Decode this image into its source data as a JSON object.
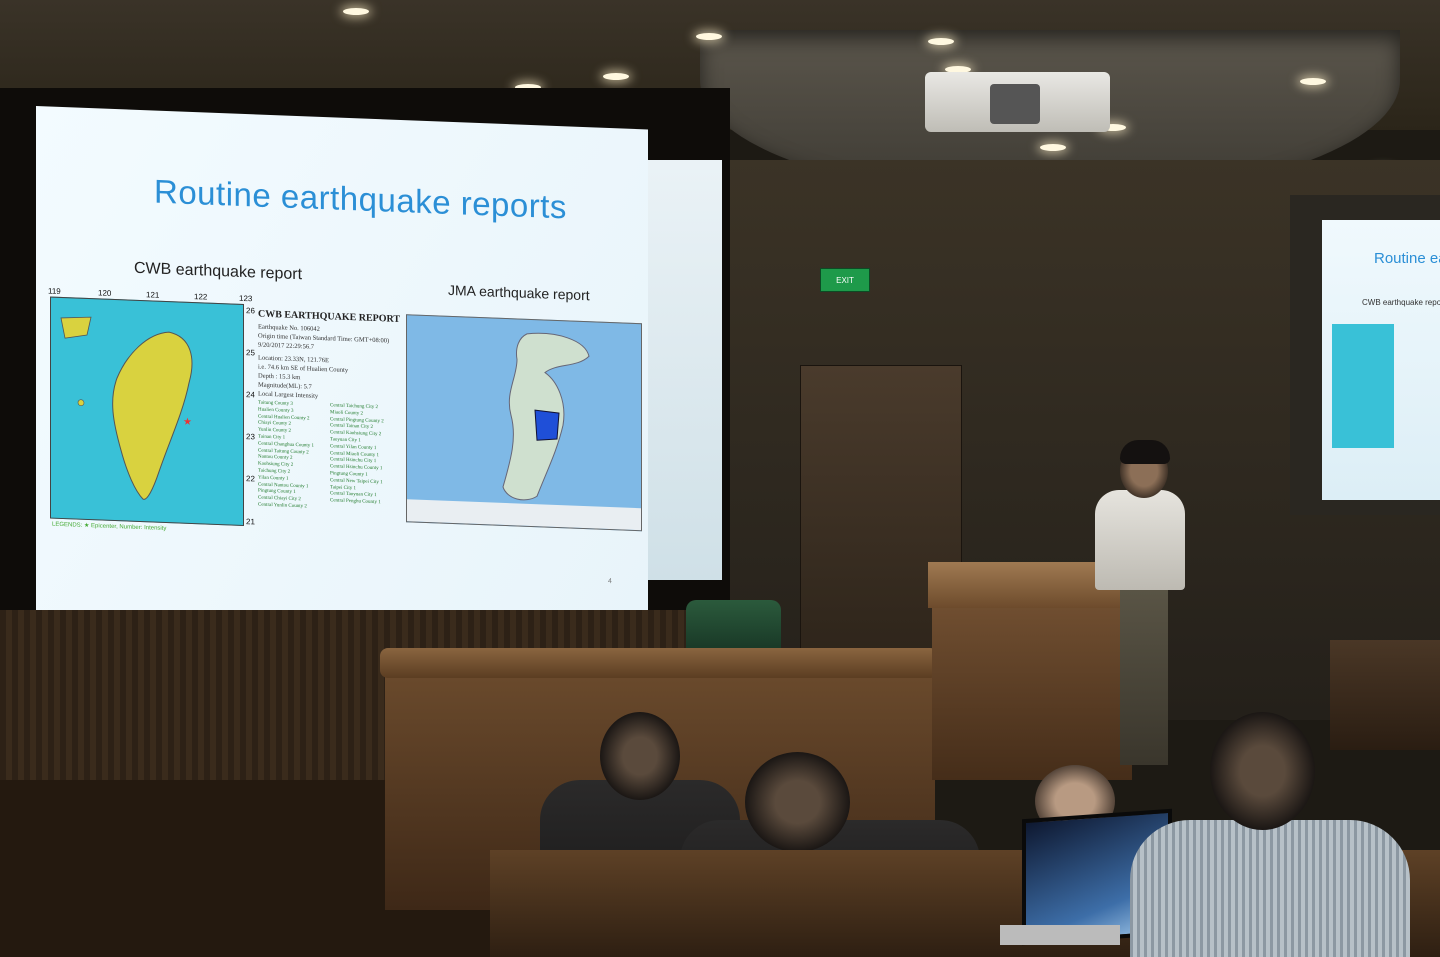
{
  "slide": {
    "title": "Routine earthquake reports",
    "left_caption": "CWB earthquake report",
    "right_caption": "JMA earthquake report",
    "page_number": "4",
    "cwb_report": {
      "heading": "CWB EARTHQUAKE REPORT",
      "lines": [
        "Earthquake No. 106042",
        "Origin time (Taiwan Standard Time: GMT+08:00)",
        "9/20/2017 22:29:56.7",
        "Location: 23.33N, 121.76E",
        "i.e. 74.6 km SE of Hualien County",
        "Depth : 15.3 km",
        "Magnitude(ML): 5.7",
        "Local Largest Intensity"
      ],
      "intensities": [
        "Taitung County 3",
        "Hualien County 3",
        "Central Hualien County 2",
        "Chiayi County 2",
        "Yunlin County 2",
        "Tainan City 1",
        "Central Changhua County 1",
        "Central Taitung County 2",
        "Nantou County 2",
        "Kaohsiung City 2",
        "Taichung City 2",
        "Yilan County 1",
        "Central Nantou County 1",
        "Pingtung County 1",
        "Central Chiayi City 2",
        "Central Yunlin County 2"
      ],
      "intensities_b": [
        "Central Taichung City 2",
        "Miaoli County 2",
        "Central Pingtung County 2",
        "Central Tainan City 2",
        "Central Kaohsiung City 2",
        "Taoyuan City 1",
        "Central Yilan County 1",
        "Central Miaoli County 1",
        "Central Hsinchu City 1",
        "Central Hsinchu County 1",
        "Pingtung County 1",
        "Central New Taipei City 1",
        "Taipei City 1",
        "Central Taoyuan City 1",
        "Central Penghu County 1"
      ],
      "legend": "LEGENDS: ★ Epicenter, Number: Intensity",
      "longitudes": [
        "119",
        "120",
        "121",
        "122",
        "123"
      ],
      "latitudes": [
        "26",
        "25",
        "24",
        "23",
        "22",
        "21"
      ]
    }
  },
  "right_screen": {
    "title": "Routine ear",
    "caption": "CWB earthquake report"
  },
  "exit_sign": {
    "label": "EXIT"
  },
  "colors": {
    "slide_title": "#2b8fd6",
    "sea": "#39c1d7",
    "land": "#d9d23f",
    "jma_sea": "#7fb9e6",
    "jma_highlight": "#1f4fd8"
  }
}
